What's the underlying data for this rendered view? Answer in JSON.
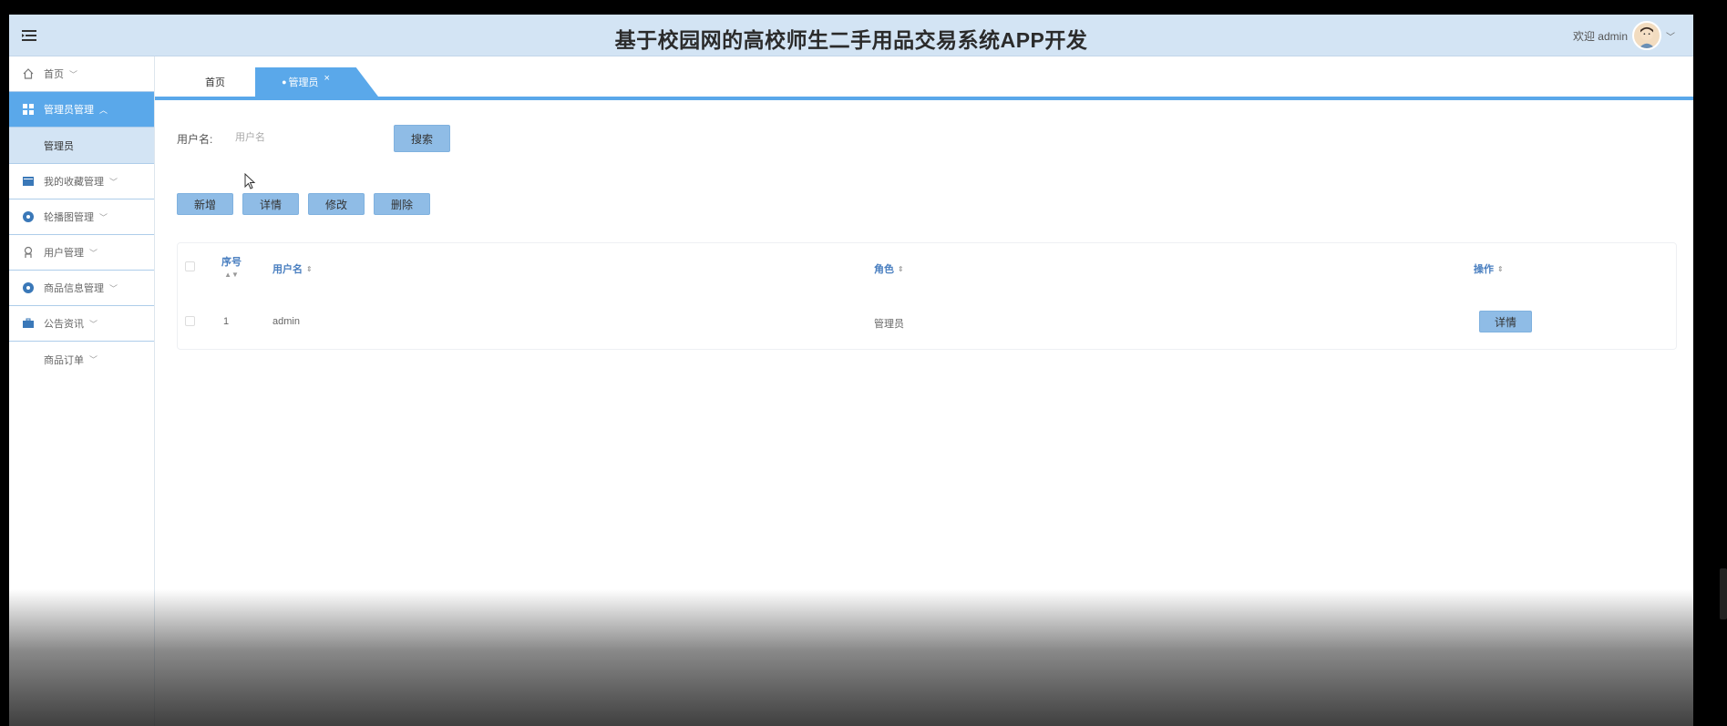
{
  "header": {
    "title": "基于校园网的高校师生二手用品交易系统APP开发",
    "welcome": "欢迎 admin"
  },
  "sidebar": {
    "items": [
      {
        "label": "首页",
        "icon": "home-icon"
      },
      {
        "label": "管理员管理",
        "icon": "grid-icon",
        "active": true,
        "sub": "管理员"
      },
      {
        "label": "我的收藏管理",
        "icon": "folder-icon"
      },
      {
        "label": "轮播图管理",
        "icon": "circle-icon"
      },
      {
        "label": "用户管理",
        "icon": "user-icon"
      },
      {
        "label": "商品信息管理",
        "icon": "circle-icon"
      },
      {
        "label": "公告资讯",
        "icon": "briefcase-icon"
      },
      {
        "label": "商品订单"
      }
    ]
  },
  "tabs": {
    "home": "首页",
    "admin": "管理员",
    "close": "×"
  },
  "search": {
    "label": "用户名:",
    "placeholder": "用户名",
    "button": "搜索"
  },
  "toolbar": {
    "add": "新增",
    "detail": "详情",
    "edit": "修改",
    "delete": "删除"
  },
  "table": {
    "columns": [
      "序号",
      "用户名",
      "角色",
      "操作"
    ],
    "rows": [
      {
        "index": "1",
        "username": "admin",
        "role": "管理员",
        "action": "详情"
      }
    ]
  },
  "colors": {
    "accent": "#5aa8ea",
    "header_bg": "#d3e4f4",
    "button": "#8fbce6"
  }
}
